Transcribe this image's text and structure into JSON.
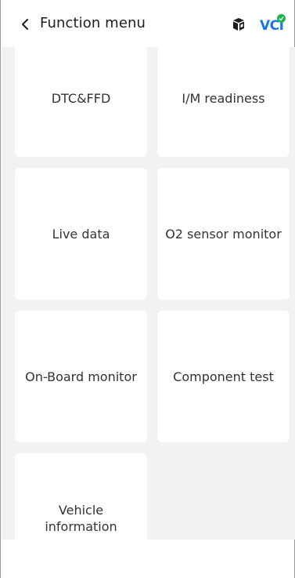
{
  "header": {
    "title": "Function menu",
    "back_icon": "chevron-left-icon",
    "cube_icon": "cube-icon",
    "vci_label": "VCI",
    "vci_status_color": "#1fb54a"
  },
  "menu": {
    "items": [
      {
        "label": "DTC&FFD"
      },
      {
        "label": "I/M readiness"
      },
      {
        "label": "Live data"
      },
      {
        "label": "O2 sensor monitor"
      },
      {
        "label": "On-Board monitor"
      },
      {
        "label": "Component test"
      },
      {
        "label": "Vehicle information"
      }
    ]
  },
  "colors": {
    "background": "#f2f2f2",
    "card": "#ffffff",
    "accent": "#1a73e8"
  }
}
